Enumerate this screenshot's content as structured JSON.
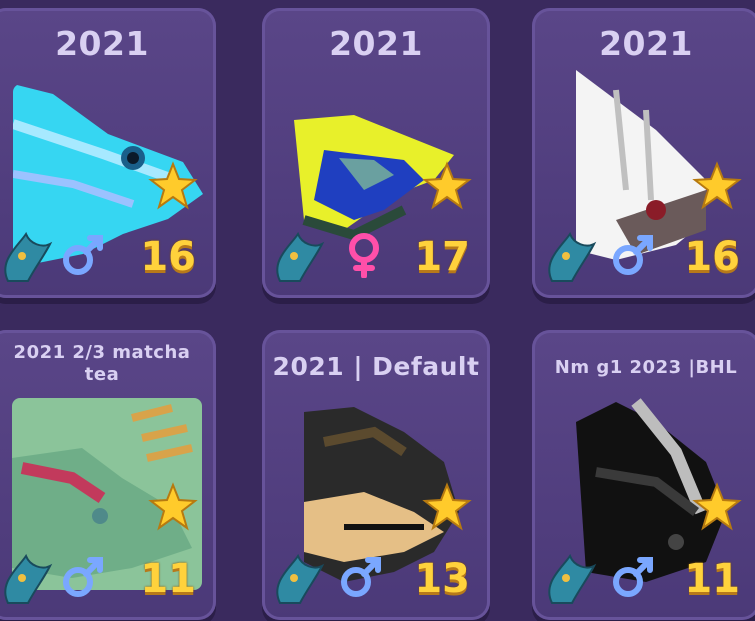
{
  "cards": [
    {
      "title": "2021",
      "level": "16",
      "gender": "male",
      "star": "star-icon",
      "colors": {
        "main": "#36d6f2",
        "accent": "#a7e9ff",
        "dark": "#1a5f8a"
      }
    },
    {
      "title": "2021",
      "level": "17",
      "gender": "female",
      "star": "star-icon",
      "colors": {
        "main": "#e8f02a",
        "accent": "#1f3fc0",
        "dark": "#2a4a3a"
      }
    },
    {
      "title": "2021",
      "level": "16",
      "gender": "male",
      "star": "star-icon",
      "colors": {
        "main": "#f4f4f4",
        "accent": "#8a1c28",
        "dark": "#3b3b3b"
      }
    },
    {
      "title": "2021 2/3 matcha tea",
      "level": "11",
      "gender": "male",
      "star": "star-icon",
      "colors": {
        "main": "#8bc49a",
        "accent": "#c23a5c",
        "dark": "#d8a34a"
      }
    },
    {
      "title": "2021 | Default",
      "level": "13",
      "gender": "male",
      "star": "star-icon",
      "colors": {
        "main": "#2a2a2a",
        "accent": "#e5bf86",
        "dark": "#5b4a2e"
      }
    },
    {
      "title": "Nm g1 2023 |BHL",
      "level": "11",
      "gender": "male",
      "star": "star-icon",
      "colors": {
        "main": "#111111",
        "accent": "#bdbdbd",
        "dark": "#3a3a3a"
      }
    }
  ],
  "palette": {
    "background": "#3a2a5e",
    "card": "#5a4688",
    "level": "#ffd23c",
    "male": "#7aa7ff",
    "female": "#ff4fa9"
  }
}
